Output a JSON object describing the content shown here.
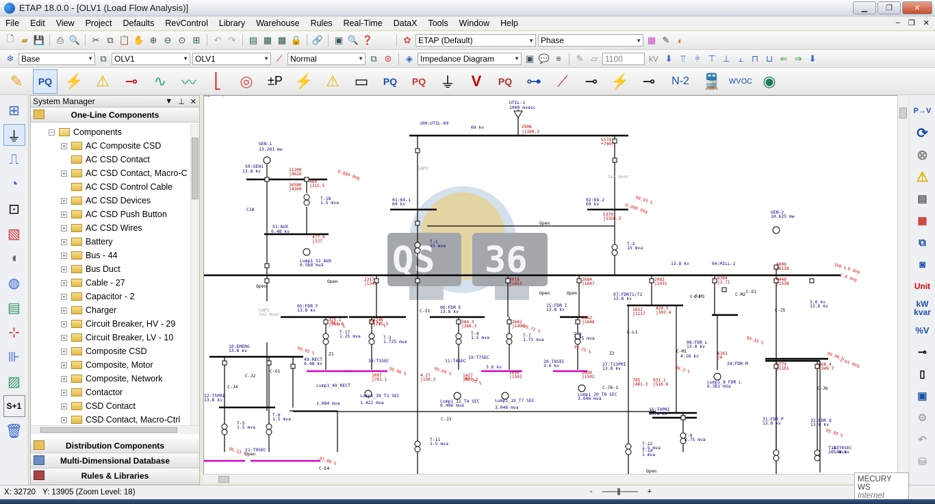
{
  "window": {
    "title": "ETAP 18.0.0 - [OLV1 (Load Flow Analysis)]"
  },
  "menu": [
    "File",
    "Edit",
    "View",
    "Project",
    "Defaults",
    "RevControl",
    "Library",
    "Warehouse",
    "Rules",
    "Real-Time",
    "DataX",
    "Tools",
    "Window",
    "Help"
  ],
  "toolbar1": {
    "theme": "ETAP (Default)",
    "display": "Phase"
  },
  "toolbar2": {
    "config": "Base",
    "presentation": "OLV1",
    "revision": "OLV1",
    "mode": "Normal",
    "diagram_type": "Impedance Diagram",
    "voltage": "1100",
    "voltage_unit": "kV"
  },
  "toolbar3": {
    "n2_label": "N-2",
    "wvoc_label": "WVOC"
  },
  "system_manager": {
    "title": "System Manager",
    "top_panel": "One-Line Components",
    "root": "Components",
    "items": [
      "AC Composite CSD",
      "AC CSD Contact",
      "AC CSD Contact, Macro-C",
      "AC CSD Control Cable",
      "AC CSD Devices",
      "AC CSD Push Button",
      "AC CSD Wires",
      "Battery",
      "Bus - 44",
      "Bus Duct",
      "Cable - 27",
      "Capacitor - 2",
      "Charger",
      "Circuit Breaker, HV - 29",
      "Circuit Breaker, LV - 10",
      "Composite CSD",
      "Composite, Motor",
      "Composite, Network",
      "Contactor",
      "CSD Contact",
      "CSD Contact, Macro-Ctrl"
    ],
    "bottom_panels": [
      "Distribution Components",
      "Multi-Dimensional Database",
      "Rules & Libraries"
    ]
  },
  "right_toolbar": {
    "unit_label": "Unit",
    "kw_label": "kW",
    "kvar_label": "kvar",
    "pct_label": "%V"
  },
  "diagram": {
    "watermark": [
      "QS",
      "36"
    ],
    "labels": [
      {
        "t": "UTIL-1",
        "c": "#000080"
      },
      {
        "t": "1000 mvasc",
        "c": "#000080"
      },
      {
        "t": "100:UTIL-69",
        "c": "#000080"
      },
      {
        "t": "69 kv",
        "c": "#000080"
      },
      {
        "t": "GEN-1",
        "c": "#000080"
      },
      {
        "t": "13.281 mw",
        "c": "#000080"
      },
      {
        "t": "50:GEN1",
        "c": "#000080"
      },
      {
        "t": "13.8 kv",
        "c": "#000080"
      },
      {
        "t": "T-18",
        "c": "#000080"
      },
      {
        "t": "1.5 mva",
        "c": "#000080"
      },
      {
        "t": "C1A",
        "c": "#000080"
      },
      {
        "t": "51:AUX",
        "c": "#000080"
      },
      {
        "t": "0.48 kv",
        "c": "#000080"
      },
      {
        "t": "Lump1_51_AUX",
        "c": "#000080"
      },
      {
        "t": "0.568 mva",
        "c": "#000080"
      },
      {
        "t": "01:69-1",
        "c": "#000080"
      },
      {
        "t": "69 kv",
        "c": "#000080"
      },
      {
        "t": "02:69-2",
        "c": "#000080"
      },
      {
        "t": "69 kv",
        "c": "#000080"
      },
      {
        "t": "T-1",
        "c": "#000080"
      },
      {
        "t": "15 mva",
        "c": "#000080"
      },
      {
        "t": "T-2",
        "c": "#000080"
      },
      {
        "t": "15 mva",
        "c": "#000080"
      },
      {
        "t": "GEN-2",
        "c": "#000080"
      },
      {
        "t": "10.625 mw",
        "c": "#000080"
      },
      {
        "t": "13.8 kv",
        "c": "#000080"
      },
      {
        "t": "04:MILL-2",
        "c": "#000080"
      },
      {
        "t": "05:FDR F",
        "c": "#000080"
      },
      {
        "t": "13.8 kv",
        "c": "#000080"
      },
      {
        "t": "06:FDR E",
        "c": "#000080"
      },
      {
        "t": "13.8 kv",
        "c": "#000080"
      },
      {
        "t": "15:FDR I",
        "c": "#000080"
      },
      {
        "t": "13.8 kv",
        "c": "#000080"
      },
      {
        "t": "07:FDR71/72",
        "c": "#000080"
      },
      {
        "t": "13.8 kv",
        "c": "#000080"
      },
      {
        "t": "T-17",
        "c": "#000080"
      },
      {
        "t": "1.25 mva",
        "c": "#000080"
      },
      {
        "t": "T-3",
        "c": "#000080"
      },
      {
        "t": "1.725 mva",
        "c": "#000080"
      },
      {
        "t": "T-4",
        "c": "#000080"
      },
      {
        "t": "1.5 mva",
        "c": "#000080"
      },
      {
        "t": "T-7",
        "c": "#000080"
      },
      {
        "t": "3.75 mva",
        "c": "#000080"
      },
      {
        "t": "T-8",
        "c": "#000080"
      },
      {
        "t": "3.75 mva",
        "c": "#000080"
      },
      {
        "t": "08:FDR L",
        "c": "#000080"
      },
      {
        "t": "13.8 kv",
        "c": "#000080"
      },
      {
        "t": "24:FDR M",
        "c": "#000080"
      },
      {
        "t": "10:EMERG",
        "c": "#000080"
      },
      {
        "t": "13.8 kv",
        "c": "#000080"
      },
      {
        "t": "49:RECT",
        "c": "#000080"
      },
      {
        "t": "0.48 kv",
        "c": "#000080"
      },
      {
        "t": "39:T3SEC",
        "c": "#000080"
      },
      {
        "t": "11:T4SEC",
        "c": "#000080"
      },
      {
        "t": "19:T7SEC",
        "c": "#000080"
      },
      {
        "t": "3.6 kv",
        "c": "#000080"
      },
      {
        "t": "20:T8SEC",
        "c": "#000080"
      },
      {
        "t": "3.6 kv",
        "c": "#000080"
      },
      {
        "t": "27:T13PRI",
        "c": "#000080"
      },
      {
        "t": "13.8 kv",
        "c": "#000080"
      },
      {
        "t": "Lump1_49_RECT",
        "c": "#000080"
      },
      {
        "t": "1.084 mva",
        "c": "#000080"
      },
      {
        "t": "Lump1_39_T3 SEC",
        "c": "#000080"
      },
      {
        "t": "1.422 mva",
        "c": "#000080"
      },
      {
        "t": "Lump1_11_T4 SEC",
        "c": "#000080"
      },
      {
        "t": "0.406 mva",
        "c": "#000080"
      },
      {
        "t": "Lump1_19_T7 SEC",
        "c": "#000080"
      },
      {
        "t": "3.046 mva",
        "c": "#000080"
      },
      {
        "t": "Lump1_20_T8 SEC",
        "c": "#000080"
      },
      {
        "t": "3.046 mva",
        "c": "#000080"
      },
      {
        "t": "Lump1_8_FDR L",
        "c": "#000080"
      },
      {
        "t": "6.361 mva",
        "c": "#000080"
      },
      {
        "t": "12:T5PRI",
        "c": "#000080"
      },
      {
        "t": "13.8 kv",
        "c": "#000080"
      },
      {
        "t": "16:T9PRI",
        "c": "#000080"
      },
      {
        "t": "13.8 kv",
        "c": "#000080"
      },
      {
        "t": "31:FDR P",
        "c": "#000080"
      },
      {
        "t": "13.8 kv",
        "c": "#000080"
      },
      {
        "t": "32:FDR Q",
        "c": "#000080"
      },
      {
        "t": "13.8 kv",
        "c": "#000080"
      },
      {
        "t": "T-5",
        "c": "#000080"
      },
      {
        "t": "1.5 mva",
        "c": "#000080"
      },
      {
        "t": "T-6",
        "c": "#000080"
      },
      {
        "t": "1.5 mva",
        "c": "#000080"
      },
      {
        "t": "T-9",
        "c": "#000080"
      },
      {
        "t": "3.75 mva",
        "c": "#000080"
      },
      {
        "t": "T-11",
        "c": "#000080"
      },
      {
        "t": "1.5 mva",
        "c": "#000080"
      },
      {
        "t": "T-12",
        "c": "#000080"
      },
      {
        "t": "1.5 mva",
        "c": "#000080"
      },
      {
        "t": "T-13",
        "c": "#000080"
      },
      {
        "t": "2.5 mva",
        "c": "#000080"
      },
      {
        "t": "T-14",
        "c": "#000080"
      },
      {
        "t": "1 mva",
        "c": "#000080"
      },
      {
        "t": "18:T6SEC",
        "c": "#000080"
      },
      {
        "t": "0.48 kv",
        "c": "#000080"
      },
      {
        "t": "21:T9SEC",
        "c": "#000080"
      },
      {
        "t": "Open",
        "c": "#000000"
      },
      {
        "t": "Open",
        "c": "#000000"
      },
      {
        "t": "Open",
        "c": "#000000"
      },
      {
        "t": "Open",
        "c": "#000000"
      },
      {
        "t": "Open",
        "c": "#000000"
      },
      {
        "t": "Open",
        "c": "#000000"
      },
      {
        "t": "Open",
        "c": "#000000"
      },
      {
        "t": "C-F1",
        "c": "#000000"
      },
      {
        "t": "C-E1",
        "c": "#000000"
      },
      {
        "t": "C-I1",
        "c": "#000000"
      },
      {
        "t": "C-L1",
        "c": "#000000"
      },
      {
        "t": "C-M1",
        "c": "#000000"
      },
      {
        "t": "C-G1",
        "c": "#000000"
      },
      {
        "t": "C-J2",
        "c": "#000000"
      },
      {
        "t": "C-J3",
        "c": "#000000"
      },
      {
        "t": "C-J4",
        "c": "#000000"
      },
      {
        "t": "C-J5",
        "c": "#000000"
      },
      {
        "t": "C-J6",
        "c": "#000000"
      },
      {
        "t": "C-E4",
        "c": "#000000"
      },
      {
        "t": "C-M2",
        "c": "#000000"
      },
      {
        "t": "C-M3",
        "c": "#000000"
      },
      {
        "t": "C-76-1",
        "c": "#000000"
      },
      {
        "t": "X1",
        "c": "#000000"
      },
      {
        "t": "Z1",
        "c": "#000000"
      },
      {
        "t": "Z2",
        "c": "#000000"
      },
      {
        "t": "4.16 kv",
        "c": "#000080"
      },
      {
        "t": "3.6 kv",
        "c": "#000080"
      },
      {
        "t": "13.8 kv",
        "c": "#000080"
      },
      {
        "t": "CAP1",
        "c": "#999999"
      },
      {
        "t": "1x2 mvar",
        "c": "#999999"
      },
      {
        "t": "CAP2",
        "c": "#999999"
      },
      {
        "t": "1x2 mvar",
        "c": "#999999"
      },
      {
        "t": "Line Impedance-1",
        "c": "#999999"
      },
      {
        "t": "Line Impedance-2",
        "c": "#999999"
      }
    ],
    "flows": [
      "2906",
      "j1166.2",
      "5574",
      "+7407",
      "11200",
      "j4626",
      "480",
      "j315.5",
      "10580",
      "j4309",
      "0.884 deg",
      "-0.096 deg",
      "99.93 %",
      "5370",
      "j3358.3",
      "477.9",
      "j327",
      "2217",
      "j1341",
      "3018",
      "j1653",
      "2684",
      "j1647",
      "2082",
      "j1431",
      "6364",
      "j3.71",
      "4448",
      "j1538",
      "8000",
      "j6138",
      "100 %",
      "0 deg",
      "-1.8 deg",
      "1652",
      "j1117",
      "424.5",
      "j303.4",
      "1246",
      "j775.5",
      "375.1",
      "j264.6",
      "384.3",
      "j266.3",
      "2662",
      "j1496",
      "2662",
      "j1648",
      "6361",
      "j0",
      "1779",
      "j1101",
      "568.4",
      "j349.7",
      "4.17",
      "j150.2",
      "1097",
      "j701.1",
      "1427",
      "j870.2",
      "2650",
      "j1502",
      "2650",
      "j1502",
      "785",
      "j481.3",
      "931.1",
      "j516.6",
      "99.74 %",
      "99.72 %",
      "99.95 %",
      "99.69 %",
      "97.25 %",
      "99.96 %",
      "96.7 %",
      "98.3 %",
      "99.35 %",
      "99.96 %",
      "-1.61 deg",
      "98.75 %",
      "99.94 %",
      "96.33 %",
      "97.88 %"
    ]
  },
  "status": {
    "x": "X: 32720",
    "y": "Y: 13905 (Zoom Level: 18)",
    "zoom_minus": "-",
    "zoom_plus": "+"
  },
  "mercury": {
    "line1": "MECURY WS",
    "line2": "Internet"
  }
}
